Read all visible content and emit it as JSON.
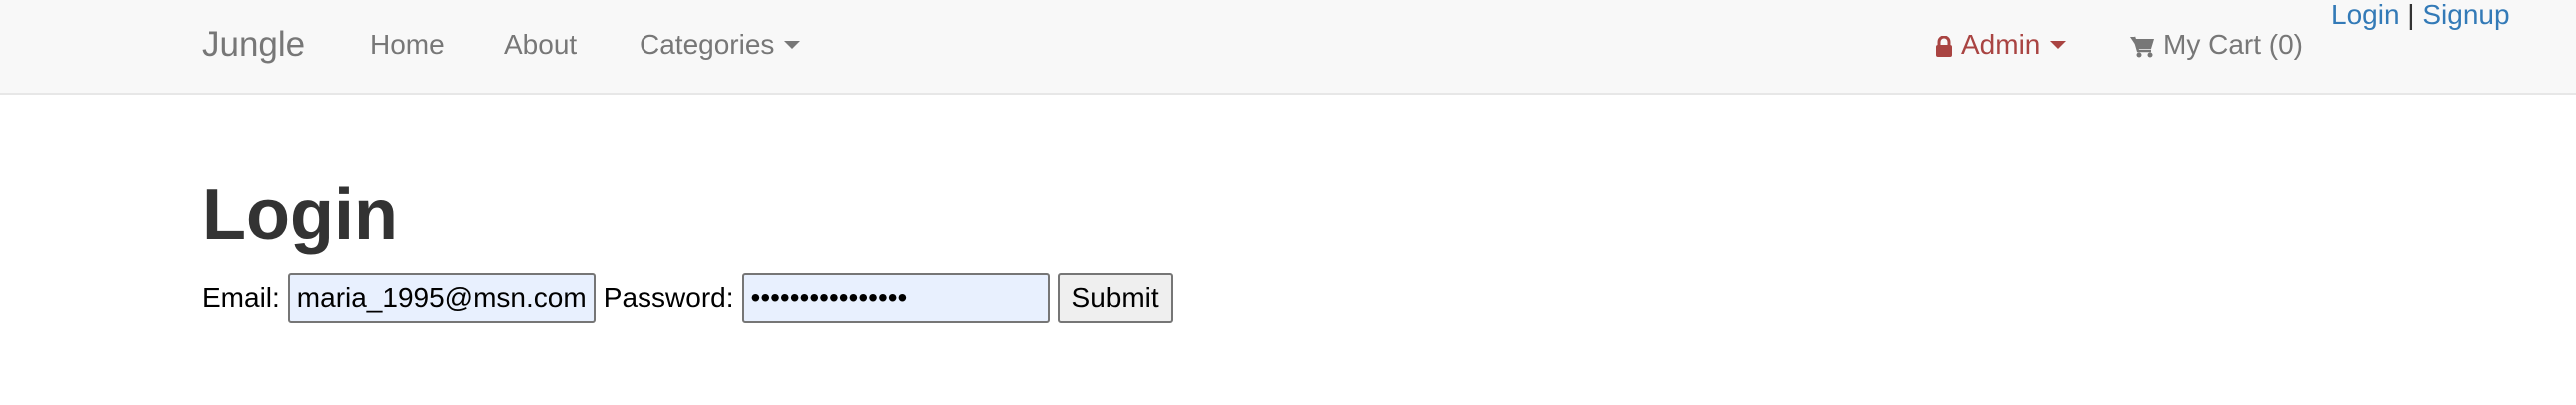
{
  "navbar": {
    "brand": "Jungle",
    "links": {
      "home": "Home",
      "about": "About",
      "categories": "Categories"
    },
    "admin": "Admin",
    "cart": "My Cart (0)",
    "auth": {
      "login": "Login",
      "separator": "|",
      "signup": "Signup"
    }
  },
  "page": {
    "title": "Login"
  },
  "form": {
    "email_label": "Email:",
    "email_value": "maria_1995@msn.com",
    "password_label": "Password:",
    "password_value": "••••••••••••••••",
    "submit_label": "Submit"
  },
  "colors": {
    "navbar_bg": "#f8f8f8",
    "nav_text": "#777777",
    "admin": "#a94442",
    "link": "#337ab7",
    "autofill_bg": "#e8f0fe"
  },
  "icons": {
    "admin": "lock-icon",
    "cart": "shopping-cart-icon",
    "dropdown": "caret-down-icon"
  }
}
